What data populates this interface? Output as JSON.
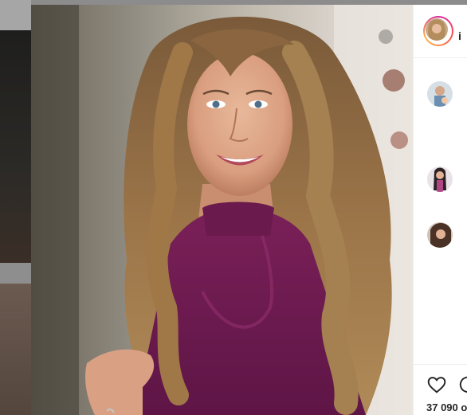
{
  "post": {
    "author_username": "i",
    "likes_text": "37 090 o"
  },
  "icons": {
    "like": "heart-icon",
    "comment": "comment-icon"
  },
  "colors": {
    "story_ring": [
      "#d6249f",
      "#fd5949",
      "#fdb54a"
    ],
    "overlay": "#8c8c8c"
  }
}
